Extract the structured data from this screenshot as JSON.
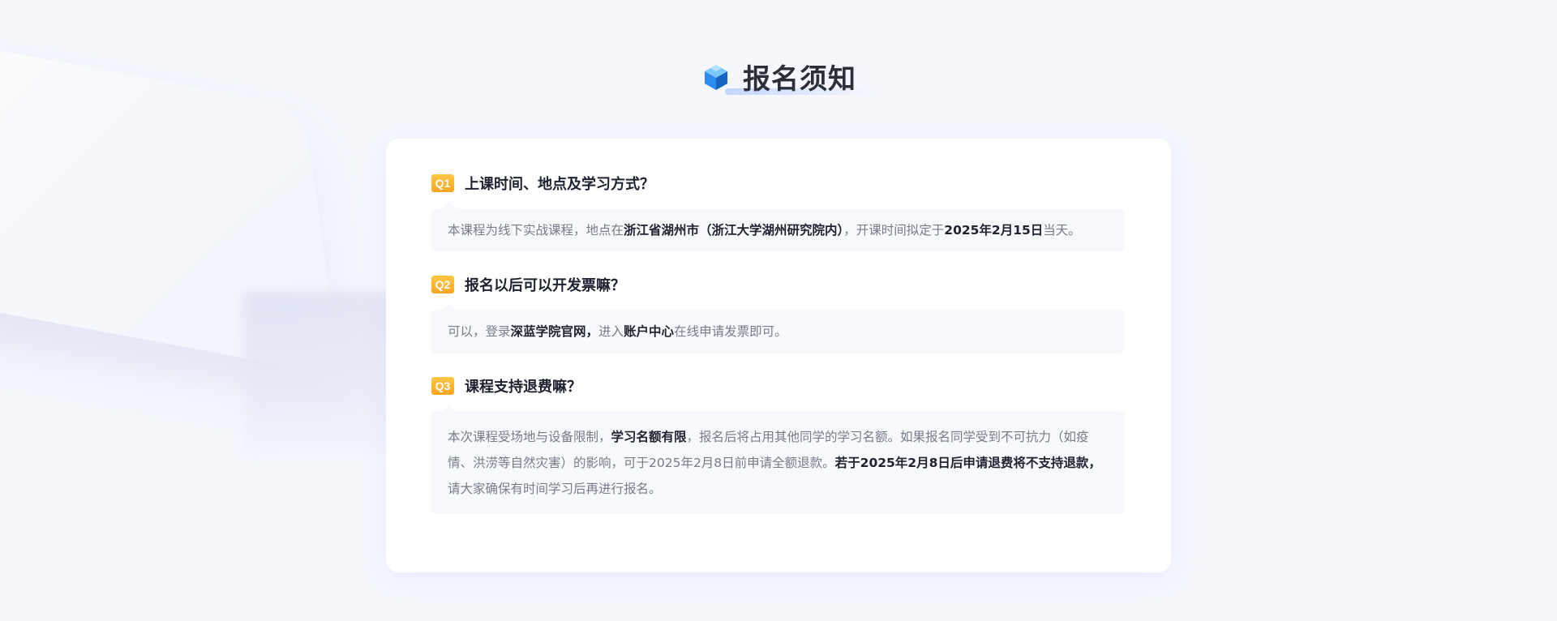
{
  "page": {
    "title": "报名须知"
  },
  "colors": {
    "badge": "#f7a623",
    "title": "#2b2f3a",
    "answer_bg": "#f7f9fd",
    "answer_text": "#777c88",
    "strong_text": "#1f2330"
  },
  "faq": [
    {
      "badge": "Q1",
      "question": "上课时间、地点及学习方式？",
      "answer": {
        "p1": "本课程为线下实战课程，地点在",
        "b1": "浙江省湖州市（浙江大学湖州研究院内）",
        "p2": "，开课时间拟定于",
        "b2": "2025年2月15日",
        "p3": "当天。"
      }
    },
    {
      "badge": "Q2",
      "question": "报名以后可以开发票嘛？",
      "answer": {
        "p1": "可以，登录",
        "b1": "深蓝学院官网，",
        "p2": "进入",
        "b2": "账户中心",
        "p3": "在线申请发票即可。"
      }
    },
    {
      "badge": "Q3",
      "question": "课程支持退费嘛？",
      "answer": {
        "p1": "本次课程受场地与设备限制，",
        "b1": "学习名额有限",
        "p2": "，报名后将占用其他同学的学习名额。如果报名同学受到不可抗力（如疫情、洪涝等自然灾害）的影响，可于2025年2月8日前申请全额退款。",
        "b2": "若于2025年2月8日后申请退费将不支持退款，",
        "p3": "请大家确保有时间学习后再进行报名。"
      }
    }
  ]
}
